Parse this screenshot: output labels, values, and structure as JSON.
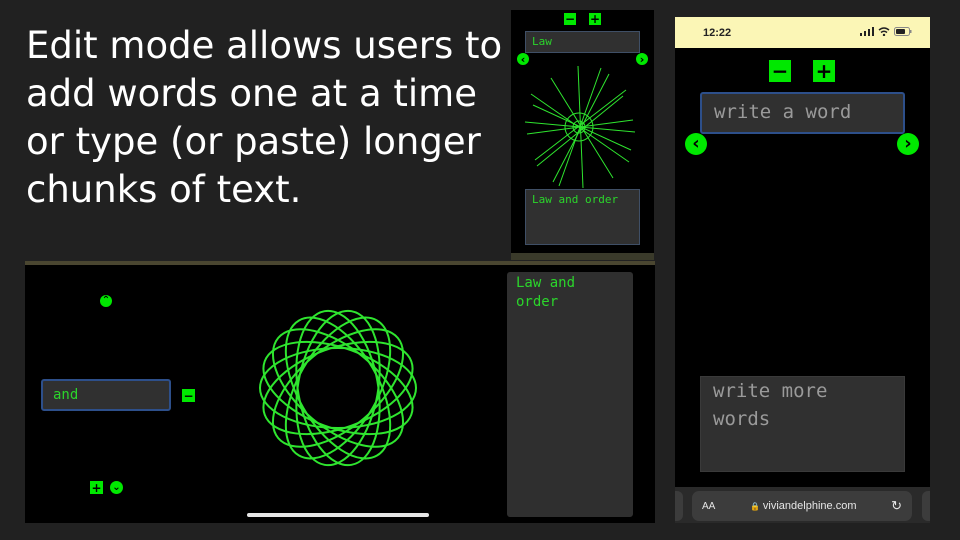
{
  "headline": "Edit mode allows users to add words one at a time or type (or paste) longer chunks of text.",
  "colors": {
    "accent": "#00e800",
    "text_green": "#2bd52b",
    "field_bg": "#303030",
    "status_bar": "#fbf6b6"
  },
  "shot_a": {
    "minus_label": "−",
    "plus_label": "+",
    "word_value": "Law",
    "prev_label": "‹",
    "next_label": "›",
    "text_value": "Law and order"
  },
  "shot_b": {
    "up_label": "⌃",
    "word_value": "and",
    "minus_label": "−",
    "plus_label": "+",
    "down_label": "⌄",
    "side_text": "Law and order"
  },
  "shot_c": {
    "time": "12:22",
    "minus_label": "−",
    "plus_label": "+",
    "word_placeholder": "write a word",
    "prev_label": "‹",
    "next_label": "›",
    "text_placeholder": "write more words",
    "aa_label": "AA",
    "lock_icon": "🔒",
    "url": "viviandelphine.com",
    "reload_label": "↻"
  }
}
